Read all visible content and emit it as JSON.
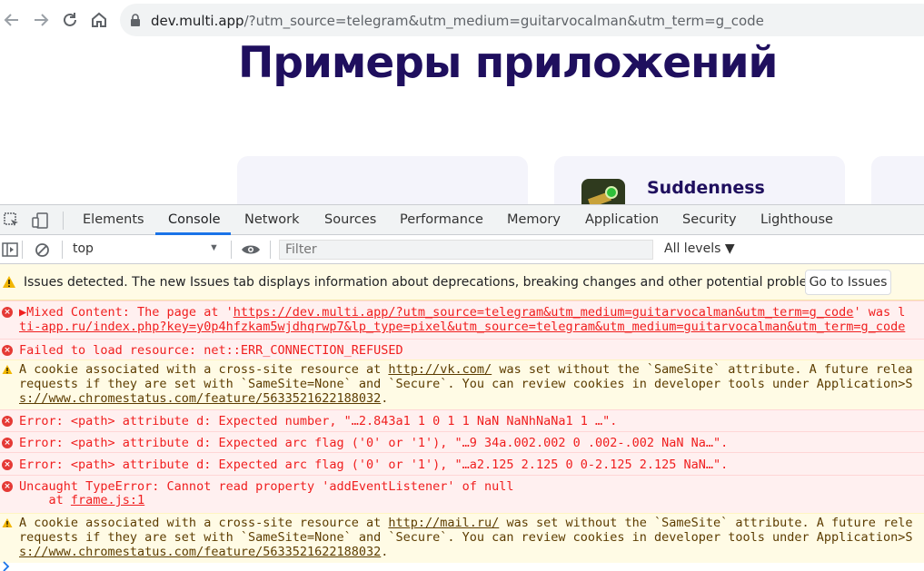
{
  "browser": {
    "url_host": "dev.multi.app",
    "url_rest": "/?utm_source=telegram&utm_medium=guitarvocalman&utm_term=g_code",
    "back_icon": "arrow-left-icon",
    "forward_icon": "arrow-right-icon",
    "reload_icon": "reload-icon",
    "home_icon": "home-icon"
  },
  "page": {
    "title": "Примеры приложений",
    "app_name": "Suddenness",
    "badge_count": "1",
    "title_color": "#1f0f5e"
  },
  "devtools": {
    "tabs": [
      "Elements",
      "Console",
      "Network",
      "Sources",
      "Performance",
      "Memory",
      "Application",
      "Security",
      "Lighthouse"
    ],
    "active_tab": "Console",
    "context": "top",
    "filter_placeholder": "Filter",
    "levels": "All levels ▼",
    "issues_text": "Issues detected. The new Issues tab displays information about deprecations, breaking changes and other potential problems.",
    "go_to_issues": "Go to Issues",
    "accent": "#1a73e8",
    "messages": [
      {
        "type": "error",
        "lines": [
          "▶Mixed Content: The page at 'https://dev.multi.app/?utm_source=telegram&utm_medium=guitarvocalman&utm_term=g_code' was l",
          "ti-app.ru/index.php?key=y0p4hfzkam5wjdhqrwp7&lp_type=pixel&utm_source=telegram&utm_medium=guitarvocalman&utm_term=g_code"
        ]
      },
      {
        "type": "error",
        "lines": [
          "Failed to load resource: net::ERR_CONNECTION_REFUSED"
        ]
      },
      {
        "type": "warn",
        "lines": [
          "A cookie associated with a cross-site resource at http://vk.com/ was set without the `SameSite` attribute. A future relea",
          "requests if they are set with `SameSite=None` and `Secure`. You can review cookies in developer tools under Application>S",
          "s://www.chromestatus.com/feature/5633521622188032."
        ]
      },
      {
        "type": "error",
        "lines": [
          "Error: <path> attribute d: Expected number, \"…2.843a1 1 0 1 1 NaN NaNhNaNa1 1 …\"."
        ]
      },
      {
        "type": "error",
        "lines": [
          "Error: <path> attribute d: Expected arc flag ('0' or '1'), \"…9 34a.002.002 0 .002-.002 NaN Na…\"."
        ]
      },
      {
        "type": "error",
        "lines": [
          "Error: <path> attribute d: Expected arc flag ('0' or '1'), \"…a2.125 2.125 0 0-2.125 2.125 NaN…\"."
        ]
      },
      {
        "type": "error",
        "lines": [
          "Uncaught TypeError: Cannot read property 'addEventListener' of null",
          "    at frame.js:1"
        ]
      },
      {
        "type": "warn",
        "lines": [
          "A cookie associated with a cross-site resource at http://mail.ru/ was set without the `SameSite` attribute. A future rele",
          "requests if they are set with `SameSite=None` and `Secure`. You can review cookies in developer tools under Application>S",
          "s://www.chromestatus.com/feature/5633521622188032."
        ]
      }
    ],
    "prompt_icon": "chevron-right-icon"
  }
}
